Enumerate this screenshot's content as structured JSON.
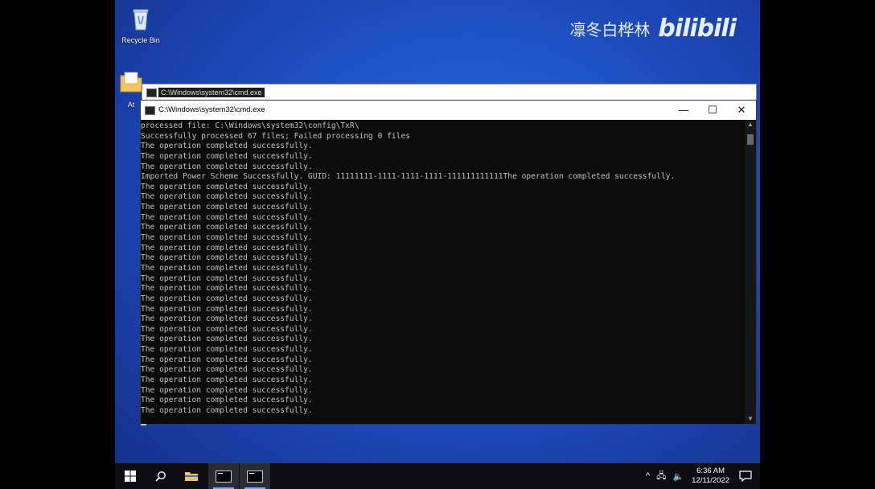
{
  "watermark": {
    "channel": "凛冬白桦林",
    "brand": "bilibili"
  },
  "desktop": {
    "icons": [
      {
        "label": "Recycle Bin",
        "icon": "recycle-bin-icon"
      },
      {
        "label": "At",
        "icon": "folder-icon"
      }
    ]
  },
  "background_window": {
    "title": "C:\\Windows\\system32\\cmd.exe"
  },
  "cmd_window": {
    "title": "C:\\Windows\\system32\\cmd.exe",
    "controls": {
      "minimize": "—",
      "maximize": "☐",
      "close": "✕"
    },
    "lines": [
      "processed file: C:\\Windows\\system32\\config\\TxR\\",
      "Successfully processed 67 files; Failed processing 0 files",
      "The operation completed successfully.",
      "The operation completed successfully.",
      "The operation completed successfully.",
      "Imported Power Scheme Successfully. GUID: 11111111-1111-1111-1111-111111111111The operation completed successfully.",
      "The operation completed successfully.",
      "The operation completed successfully.",
      "The operation completed successfully.",
      "The operation completed successfully.",
      "The operation completed successfully.",
      "The operation completed successfully.",
      "The operation completed successfully.",
      "The operation completed successfully.",
      "The operation completed successfully.",
      "The operation completed successfully.",
      "The operation completed successfully.",
      "The operation completed successfully.",
      "The operation completed successfully.",
      "The operation completed successfully.",
      "The operation completed successfully.",
      "The operation completed successfully.",
      "The operation completed successfully.",
      "The operation completed successfully.",
      "The operation completed successfully.",
      "The operation completed successfully.",
      "The operation completed successfully.",
      "The operation completed successfully.",
      "The operation completed successfully."
    ]
  },
  "taskbar": {
    "time": "6:36 AM",
    "date": "12/11/2022",
    "tray_symbols": {
      "chevron": "^",
      "network": "🖧",
      "volume": "🔈"
    },
    "colors": {
      "accent": "#7aa6ff"
    }
  }
}
